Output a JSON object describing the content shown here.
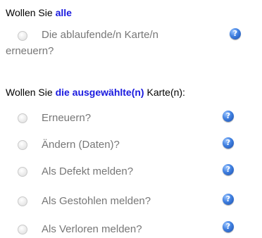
{
  "section_all": {
    "prefix": "Wollen Sie ",
    "highlight": "alle"
  },
  "renew_expiring": {
    "label_line1": "Die ablaufende/n Karte/n",
    "label_line2": "erneuern?",
    "help_glyph": "?",
    "selected": false
  },
  "section_selected": {
    "prefix": "Wollen Sie ",
    "highlight": "die ausgewählte(n)",
    "suffix": " Karte(n):"
  },
  "options": [
    {
      "label": "Erneuern?",
      "help_glyph": "?",
      "selected": false
    },
    {
      "label": "Ändern (Daten)?",
      "help_glyph": "?",
      "selected": false
    },
    {
      "label": "Als Defekt melden?",
      "help_glyph": "?",
      "selected": false
    },
    {
      "label": "Als Gestohlen melden?",
      "help_glyph": "?",
      "selected": false
    },
    {
      "label": "Als Verloren melden?",
      "help_glyph": "?",
      "selected": false
    }
  ],
  "colors": {
    "highlight": "#1a1adf",
    "label_text": "#777777",
    "help_icon": "#3f7fe0"
  }
}
